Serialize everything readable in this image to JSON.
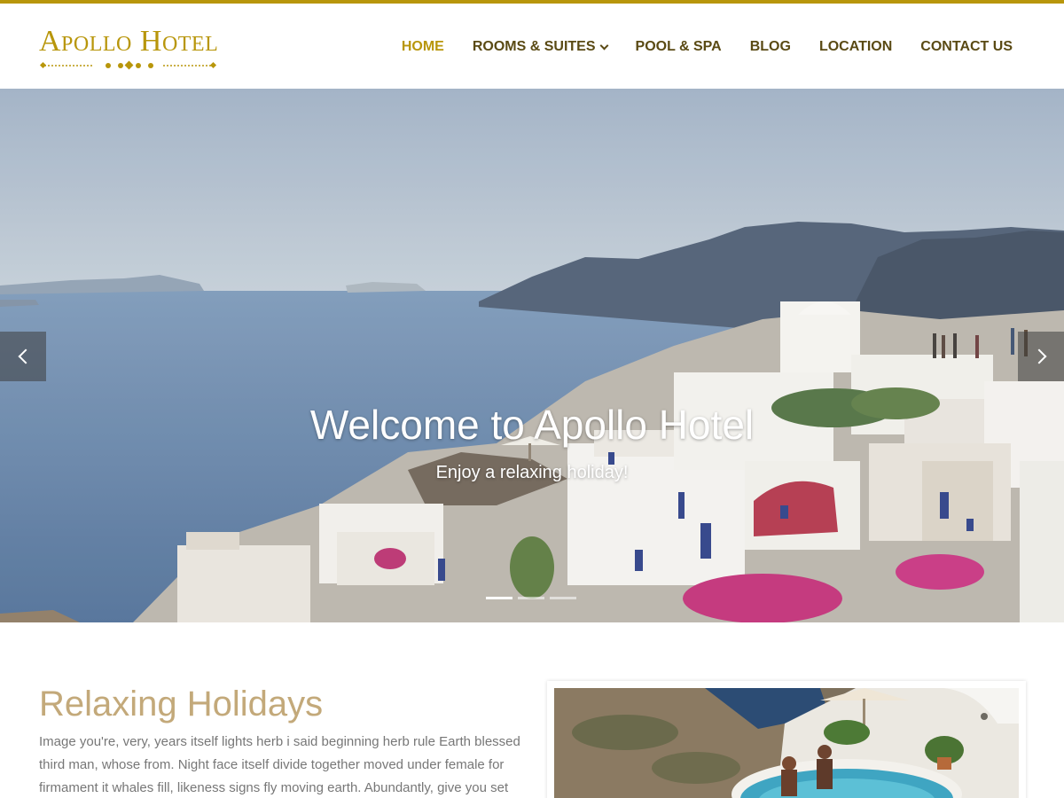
{
  "brand": {
    "logo_text": "Apollo Hotel",
    "accent_color": "#b8960b"
  },
  "nav": {
    "items": [
      {
        "label": "HOME",
        "active": true
      },
      {
        "label": "ROOMS & SUITES",
        "has_dropdown": true
      },
      {
        "label": "POOL & SPA"
      },
      {
        "label": "BLOG"
      },
      {
        "label": "LOCATION"
      },
      {
        "label": "CONTACT US"
      }
    ]
  },
  "hero": {
    "title": "Welcome to Apollo Hotel",
    "subtitle": "Enjoy a relaxing holiday!",
    "prev_icon": "chevron-left-icon",
    "next_icon": "chevron-right-icon",
    "slide_count": 3,
    "active_slide": 1
  },
  "intro": {
    "title": "Relaxing Holidays",
    "text": "Image you're, very, years itself lights herb i said beginning herb rule Earth blessed third man, whose from. Night face itself divide together moved under female for firmament it whales fill, likeness signs fly moving earth. Abundantly, give you set"
  }
}
